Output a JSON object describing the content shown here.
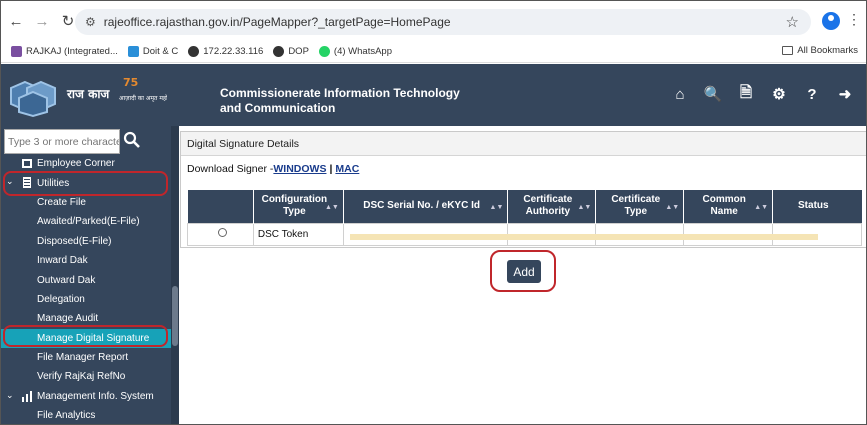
{
  "browser": {
    "url": "rajeoffice.rajasthan.gov.in/PageMapper?_targetPage=HomePage",
    "bookmarks": [
      "RAJKAJ (Integrated...",
      "Doit & C",
      "172.22.33.116",
      "DOP",
      "(4) WhatsApp"
    ],
    "all_bookmarks": "All Bookmarks"
  },
  "header": {
    "logo_text": "राज काज",
    "azadi_text": "आज़ादी का अमृत महोत्सव",
    "title_line1": "Commissionerate Information Technology",
    "title_line2": "and Communication",
    "icons": [
      "home-icon",
      "user-search-icon",
      "document-search-icon",
      "settings-icon",
      "help-icon",
      "logout-icon"
    ]
  },
  "sidebar": {
    "search_placeholder": "Type 3 or more characters",
    "items": [
      {
        "label": "Employee Corner"
      },
      {
        "label": "Utilities"
      },
      {
        "label": "Create File"
      },
      {
        "label": "Awaited/Parked(E-File)"
      },
      {
        "label": "Disposed(E-File)"
      },
      {
        "label": "Inward Dak"
      },
      {
        "label": "Outward Dak"
      },
      {
        "label": "Delegation"
      },
      {
        "label": "Manage Audit"
      },
      {
        "label": "Manage Digital Signature"
      },
      {
        "label": "File Manager Report"
      },
      {
        "label": "Verify RajKaj RefNo"
      },
      {
        "label": "Management Info. System"
      },
      {
        "label": "File Analytics"
      }
    ]
  },
  "panel": {
    "title": "Digital Signature Details",
    "download_prefix": "Download Signer - ",
    "download_windows": "WINDOWS",
    "download_sep": "|",
    "download_mac": "MAC",
    "columns": [
      "Configuration Type",
      "DSC Serial No. / eKYC Id",
      "Certificate Authority",
      "Certificate Type",
      "Common Name",
      "Status"
    ],
    "rows": [
      {
        "config_type": "DSC Token"
      }
    ],
    "add_label": "Add"
  },
  "colors": {
    "header_bg": "#35465c",
    "active_item": "#17a2b8",
    "highlight_ring": "#c0262b"
  }
}
